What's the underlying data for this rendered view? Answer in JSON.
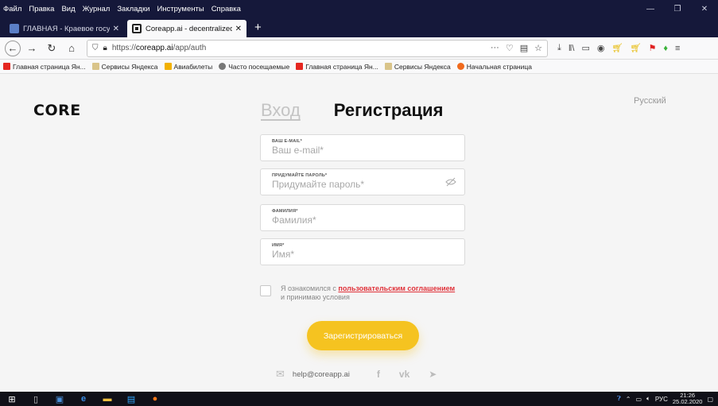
{
  "browser": {
    "menu": [
      "Файл",
      "Правка",
      "Вид",
      "Журнал",
      "Закладки",
      "Инструменты",
      "Справка"
    ],
    "window_controls": [
      "minimize",
      "maximize",
      "close"
    ],
    "tabs": [
      {
        "label": "ГЛАВНАЯ - Краевое государс",
        "icon": "site-icon",
        "active": false
      },
      {
        "label": "Coreapp.ai - decentralized onli",
        "icon": "core-icon",
        "active": true
      }
    ],
    "url_prefix": "https://",
    "url_host": "coreapp.ai",
    "url_path": "/app/auth",
    "bookmarks": [
      {
        "label": "Главная страница Ян...",
        "icon": "yandex-icon"
      },
      {
        "label": "Сервисы Яндекса",
        "icon": "folder-icon"
      },
      {
        "label": "Авиабилеты",
        "icon": "plane-icon"
      },
      {
        "label": "Часто посещаемые",
        "icon": "gear-icon"
      },
      {
        "label": "Главная страница Ян...",
        "icon": "yandex-icon"
      },
      {
        "label": "Сервисы Яндекса",
        "icon": "folder-icon"
      },
      {
        "label": "Начальная страница",
        "icon": "firefox-icon"
      }
    ]
  },
  "page": {
    "logo": "CORE",
    "language": "Русский",
    "tab_login": "Вход",
    "tab_register": "Регистрация",
    "fields": {
      "email": {
        "label": "ВАШ E-MAIL*",
        "placeholder": "Ваш e-mail*"
      },
      "password": {
        "label": "ПРИДУМАЙТЕ ПАРОЛЬ*",
        "placeholder": "Придумайте пароль*"
      },
      "lastname": {
        "label": "ФАМИЛИЯ*",
        "placeholder": "Фамилия*"
      },
      "firstname": {
        "label": "ИМЯ*",
        "placeholder": "Имя*"
      }
    },
    "agree_prefix": "Я ознакомился с",
    "agree_link": "пользовательским соглашением",
    "agree_suffix": "и принимаю условия",
    "register_button": "Зарегистрироваться",
    "footer_email": "help@coreapp.ai"
  },
  "taskbar": {
    "lang": "РУС",
    "time": "21:26",
    "date": "25.02.2020"
  },
  "colors": {
    "accent": "#f5c320",
    "link": "#e0323a",
    "titlebar": "#15183a"
  }
}
